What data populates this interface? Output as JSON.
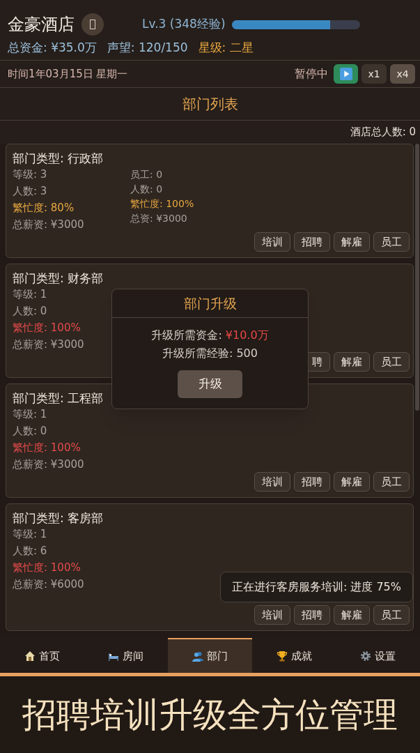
{
  "header": {
    "title": "金豪酒店",
    "level_label": "Lv.3 (348经验)",
    "xp_bar": {
      "level": 0.77
    },
    "stats": [
      {
        "text": "总资金: ¥35.0万",
        "color": "#9cc0dc"
      },
      {
        "text": "声望: 120/150",
        "color": "#9cc0dc"
      },
      {
        "text": "星级: 二星",
        "color": "#e8a840"
      }
    ]
  },
  "time_bar": {
    "date": "时间1年03月15日 星期一",
    "status": "暂停中",
    "speeds": [
      {
        "label": "x1",
        "selected": false
      },
      {
        "label": "x4",
        "selected": true
      }
    ]
  },
  "section_title": "部门列表",
  "total_staff": "酒店总人数: 0",
  "departments": [
    {
      "title": "部门类型: 行政部",
      "stats": [
        {
          "text": "等级: 3",
          "color": "#a9a29c"
        },
        {
          "text": "人数: 3",
          "color": "#a9a29c"
        },
        {
          "text": "繁忙度: 80%",
          "color": "#e8a840"
        },
        {
          "text": "总薪资: ¥3000",
          "color": "#a9a29c"
        }
      ],
      "side_stats": [
        {
          "text": "员工: 0",
          "color": "#a9a29c"
        },
        {
          "text": "人数: 0",
          "color": "#a9a29c"
        },
        {
          "text": "繁忙度: 100%",
          "color": "#e8a840"
        },
        {
          "text": "总资: ¥3000",
          "color": "#a9a29c"
        }
      ],
      "buttons": [
        "培训",
        "招聘",
        "解雇",
        "员工"
      ]
    },
    {
      "title": "部门类型: 财务部",
      "stats": [
        {
          "text": "等级: 1",
          "color": "#a9a29c"
        },
        {
          "text": "人数: 0",
          "color": "#a9a29c"
        },
        {
          "text": "繁忙度: 100%",
          "color": "#e54b4b"
        },
        {
          "text": "总薪资: ¥3000",
          "color": "#a9a29c"
        }
      ],
      "buttons": [
        "聘",
        "解雇",
        "员工"
      ]
    },
    {
      "title": "部门类型: 工程部",
      "stats": [
        {
          "text": "等级: 1",
          "color": "#a9a29c"
        },
        {
          "text": "人数: 0",
          "color": "#a9a29c"
        },
        {
          "text": "繁忙度: 100%",
          "color": "#e54b4b"
        },
        {
          "text": "总薪资: ¥3000",
          "color": "#a9a29c"
        }
      ],
      "buttons": [
        "培训",
        "招聘",
        "解雇",
        "员工"
      ]
    },
    {
      "title": "部门类型: 客房部",
      "stats": [
        {
          "text": "等级: 1",
          "color": "#a9a29c"
        },
        {
          "text": "人数: 6",
          "color": "#a9a29c"
        },
        {
          "text": "繁忙度: 100%",
          "color": "#e54b4b"
        },
        {
          "text": "总薪资: ¥6000",
          "color": "#a9a29c"
        }
      ],
      "notice": "正在进行客房服务培训: 进度 75%",
      "buttons": [
        "培训",
        "招聘",
        "解雇",
        "员工"
      ]
    }
  ],
  "upgrade_dialog": {
    "title": "部门升级",
    "lines": [
      {
        "label": "升级所需资金:",
        "value": "¥10.0万",
        "color": "#e84848"
      },
      {
        "label": "升级所需经验:",
        "value": "500",
        "color": "#d8d0c8"
      }
    ],
    "button": "升级"
  },
  "nav": [
    {
      "label": "首页",
      "selected": false
    },
    {
      "label": "房间",
      "selected": false
    },
    {
      "label": "部门",
      "selected": true
    },
    {
      "label": "成就",
      "selected": false
    },
    {
      "label": "设置",
      "selected": false
    }
  ],
  "banner": "招聘培训升级全方位管理"
}
